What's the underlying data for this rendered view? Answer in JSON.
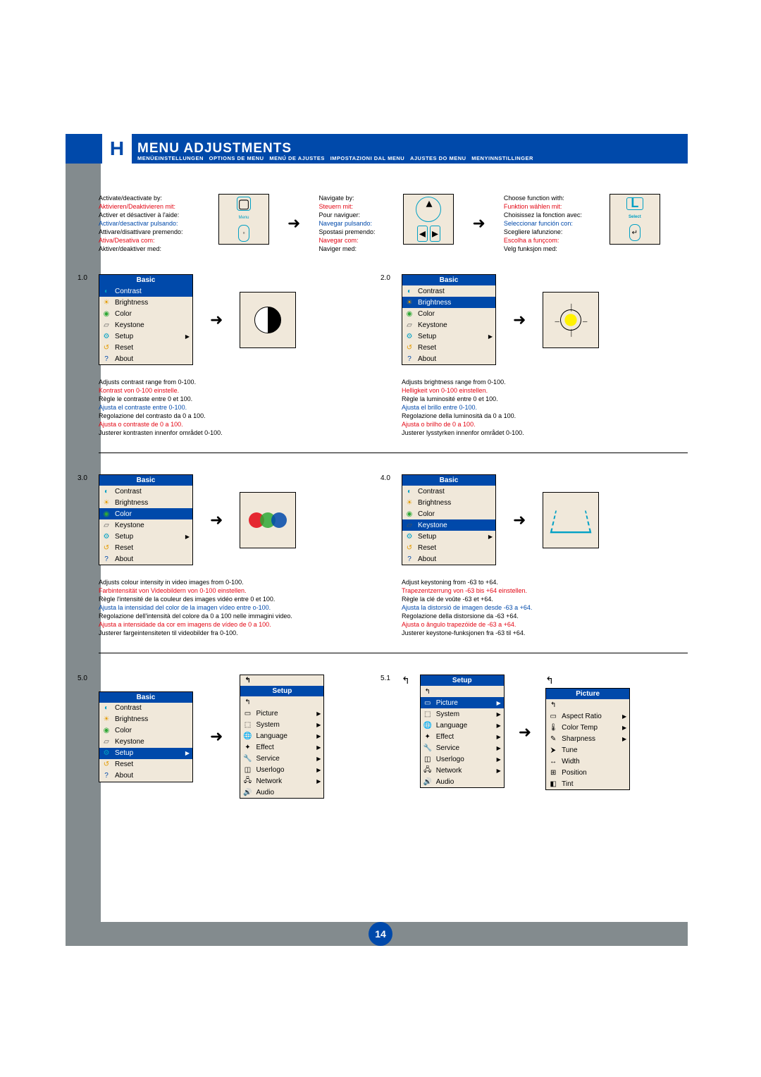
{
  "page_number": "14",
  "section_letter": "H",
  "header_title": "MENU ADJUSTMENTS",
  "header_sub": "MENÜEINSTELLUNGEN   OPTIONS DE MENU   MENÚ DE AJUSTES   IMPOSTAZIONI DAL MENU   AJUSTES DO MENU   MENYINNSTILLINGER",
  "intro": {
    "activate": {
      "en": "Activate/deactivate by:",
      "de": "Aktivieren/Deaktivieren mit:",
      "fr": "Activer et désactiver à l'aide:",
      "es": "Activar/desactivar pulsando:",
      "it": "Attivare/disattivare premendo:",
      "pt": "Ativa/Desativa com:",
      "no": "Aktiver/deaktiver med:"
    },
    "navigate": {
      "en": "Navigate by:",
      "de": "Steuern mit:",
      "fr": "Pour naviguer:",
      "es": "Navegar pulsando:",
      "it": "Spostasi premendo:",
      "pt": "Navegar com:",
      "no": "Naviger med:"
    },
    "choose": {
      "en": "Choose function with:",
      "de": "Funktion wählen mit:",
      "fr": "Choisissez la fonction avec:",
      "es": "Seleccionar función con:",
      "it": "Scegliere lafunzione:",
      "pt": "Escolha a funçcom:",
      "no": "Velg funksjon med:"
    },
    "button_menu": "Menu",
    "button_select": "Select",
    "button_l": "L"
  },
  "menu": {
    "basic": "Basic",
    "contrast": "Contrast",
    "brightness": "Brightness",
    "color": "Color",
    "keystone": "Keystone",
    "setup": "Setup",
    "reset": "Reset",
    "about": "About"
  },
  "setup_menu": {
    "title": "Setup",
    "picture": "Picture",
    "system": "System",
    "language": "Language",
    "effect": "Effect",
    "service": "Service",
    "userlogo": "Userlogo",
    "network": "Network",
    "audio": "Audio"
  },
  "picture_menu": {
    "title": "Picture",
    "aspect": "Aspect Ratio",
    "colortemp": "Color Temp",
    "sharpness": "Sharpness",
    "tune": "Tune",
    "width": "Width",
    "position": "Position",
    "tint": "Tint"
  },
  "s1": {
    "num": "1.0",
    "en": "Adjusts contrast range from 0-100.",
    "de": "Kontrast von 0-100 einstelle.",
    "fr": "Règle le contraste entre 0 et 100.",
    "es": "Ajusta el contraste entre 0-100.",
    "it": "Regolazione del contrasto da 0 a 100.",
    "pt": "Ajusta o contraste de 0 a 100.",
    "no": "Justerer kontrasten innenfor området 0-100."
  },
  "s2": {
    "num": "2.0",
    "en": "Adjusts brightness range from 0-100.",
    "de": "Helligkeit von 0-100 einstellen.",
    "fr": "Règle la luminosité entre 0 et 100.",
    "es": "Ajusta el brillo entre 0-100.",
    "it": "Regolazione della luminosità da 0 a 100.",
    "pt": "Ajusta o brilho de 0 a 100.",
    "no": "Justerer lysstyrken innenfor området 0-100."
  },
  "s3": {
    "num": "3.0",
    "en": "Adjusts colour intensity in video images from 0-100.",
    "de": "Farbintensität von Videobildern von 0-100 einstellen.",
    "fr": "Règle l'intensité de la couleur des images vidéo entre 0 et 100.",
    "es": "Ajusta la intensidad del color de la imagen vídeo entre o-100.",
    "it": "Regolazione dell'intensità del colore da 0 a 100 nelle immagini video.",
    "pt": "Ajusta a intensidade da cor em imagens de vídeo de 0 a 100.",
    "no": "Justerer fargeintensiteten til videobilder fra 0-100."
  },
  "s4": {
    "num": "4.0",
    "en": "Adjust keystoning from -63 to +64.",
    "de": "Trapezentzerrung von -63 bis +64 einstellen.",
    "fr": "Règle la clé de voûte -63 et +64.",
    "es": "Ajusta la distorsió de imagen desde -63 a +64.",
    "it": "Regolazione della distorsione da -63 +64.",
    "pt": "Ajusta o ângulo trapezóide de -63 a +64.",
    "no": "Justerer keystone-funksjonen fra -63 til +64."
  },
  "s5": {
    "num": "5.0"
  },
  "s51": {
    "num": "5.1"
  }
}
